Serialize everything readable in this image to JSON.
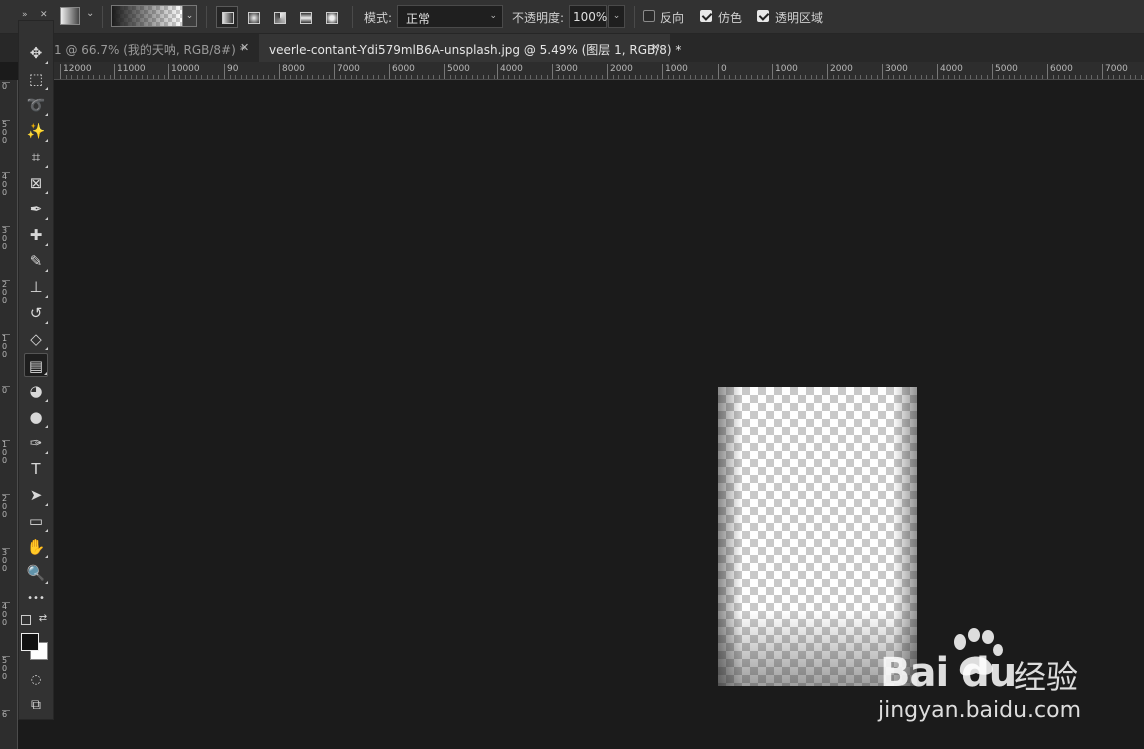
{
  "options_bar": {
    "mode_label": "模式:",
    "mode_value": "正常",
    "opacity_label": "不透明度:",
    "opacity_value": "100%",
    "reverse_label": "反向",
    "reverse_checked": false,
    "dither_label": "仿色",
    "dither_checked": true,
    "transparency_label": "透明区域",
    "transparency_checked": true
  },
  "tabs": [
    {
      "label": "1 @ 66.7% (我的天呐, RGB/8#) *",
      "active": false,
      "close": "✕"
    },
    {
      "label": "veerle-contant-Ydi579mlB6A-unsplash.jpg @ 5.49% (图层 1, RGB/8) *",
      "active": true,
      "close": "✕"
    }
  ],
  "ruler": {
    "h_labels": [
      "12000",
      "11000",
      "10000",
      "90",
      "8000",
      "7000",
      "6000",
      "5000",
      "4000",
      "3000",
      "2000",
      "1000",
      "0",
      "1000",
      "2000",
      "3000",
      "4000",
      "5000",
      "6000",
      "7000"
    ],
    "v_labels": [
      "0",
      "5\n0\n0",
      "4\n0\n0",
      "3\n0\n0",
      "2\n0\n0",
      "1\n0\n0",
      "0",
      "1\n0\n0",
      "2\n0\n0",
      "3\n0\n0",
      "4\n0\n0",
      "5\n0\n0",
      "6"
    ]
  },
  "toolbar": {
    "collapse_glyph": "»",
    "close_glyph": "✕",
    "tools": [
      {
        "name": "move-tool",
        "glyph": "✥"
      },
      {
        "name": "marquee-tool",
        "glyph": "⬚"
      },
      {
        "name": "lasso-tool",
        "glyph": "➰"
      },
      {
        "name": "magic-wand-tool",
        "glyph": "✨"
      },
      {
        "name": "crop-tool",
        "glyph": "⌗"
      },
      {
        "name": "frame-tool",
        "glyph": "⊠"
      },
      {
        "name": "eyedropper-tool",
        "glyph": "✒"
      },
      {
        "name": "healing-brush-tool",
        "glyph": "✚"
      },
      {
        "name": "brush-tool",
        "glyph": "✎"
      },
      {
        "name": "clone-stamp-tool",
        "glyph": "⊥"
      },
      {
        "name": "history-brush-tool",
        "glyph": "↺"
      },
      {
        "name": "eraser-tool",
        "glyph": "◇"
      },
      {
        "name": "gradient-tool",
        "glyph": "▤"
      },
      {
        "name": "blur-tool",
        "glyph": "◕"
      },
      {
        "name": "dodge-tool",
        "glyph": "●"
      },
      {
        "name": "pen-tool",
        "glyph": "✑"
      },
      {
        "name": "type-tool",
        "glyph": "T"
      },
      {
        "name": "path-selection-tool",
        "glyph": "➤"
      },
      {
        "name": "rectangle-tool",
        "glyph": "▭"
      },
      {
        "name": "hand-tool",
        "glyph": "✋"
      },
      {
        "name": "zoom-tool",
        "glyph": "🔍"
      },
      {
        "name": "more-tools",
        "glyph": "•••"
      }
    ],
    "quick_mask_glyph": "◌",
    "screen_mode_glyph": "⧉"
  },
  "watermark": {
    "brand": "Bai  du",
    "cn": "经验",
    "url": "jingyan.baidu.com"
  }
}
